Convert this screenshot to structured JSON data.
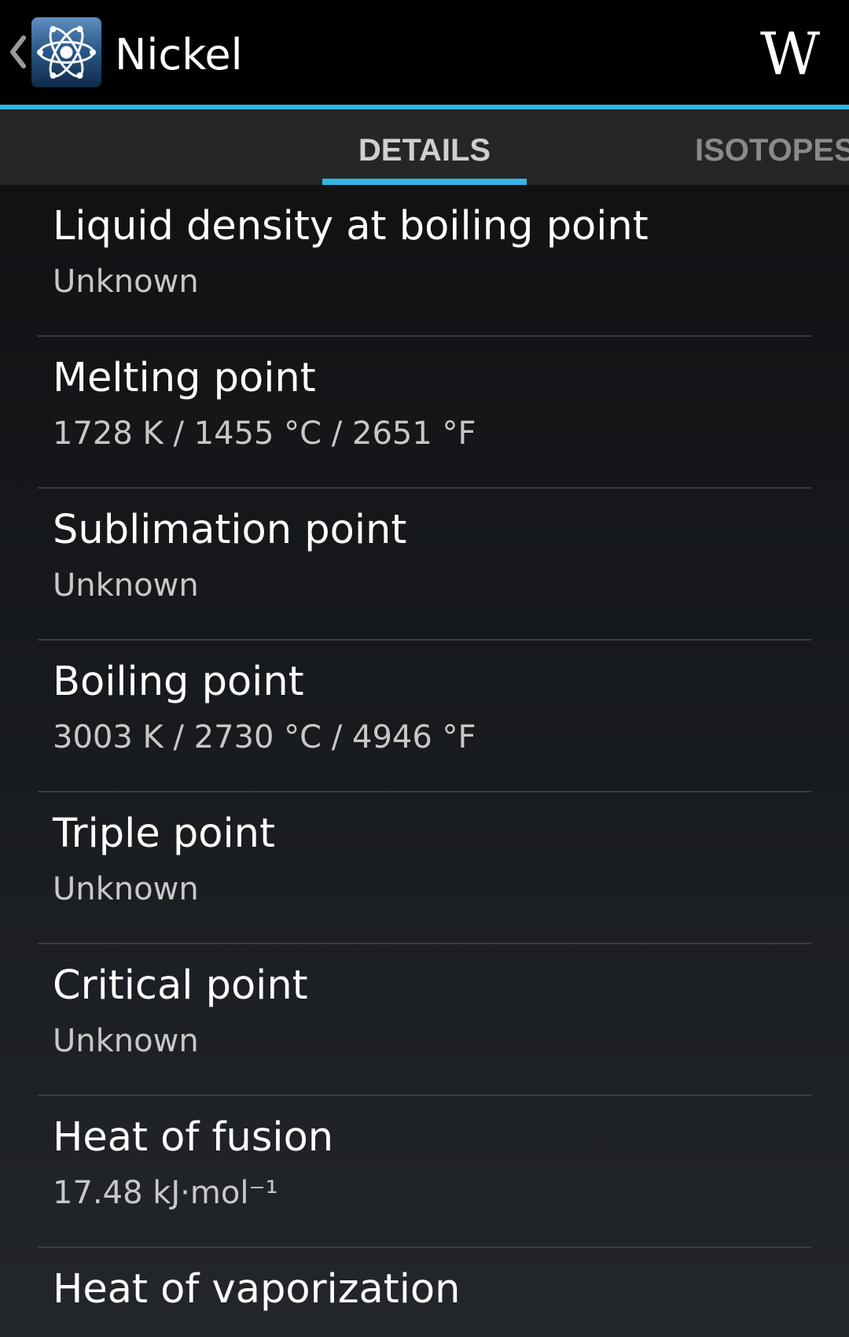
{
  "action_bar": {
    "title": "Nickel",
    "back_icon": "chevron-left-icon",
    "app_icon": "atom-icon",
    "wiki_label": "W",
    "accent_color": "#33b5e5"
  },
  "tabs": [
    {
      "label": "DETAILS",
      "selected": true
    },
    {
      "label": "ISOTOPES",
      "selected": false
    }
  ],
  "details": [
    {
      "label": "Liquid density at boiling point",
      "value": "Unknown"
    },
    {
      "label": "Melting point",
      "value": "1728 K / 1455 °C / 2651 °F"
    },
    {
      "label": "Sublimation point",
      "value": "Unknown"
    },
    {
      "label": "Boiling point",
      "value": "3003 K / 2730 °C / 4946 °F"
    },
    {
      "label": "Triple point",
      "value": "Unknown"
    },
    {
      "label": "Critical point",
      "value": "Unknown"
    },
    {
      "label": "Heat of fusion",
      "value": "17.48 kJ·mol⁻¹"
    },
    {
      "label": "Heat of vaporization",
      "value": ""
    }
  ]
}
